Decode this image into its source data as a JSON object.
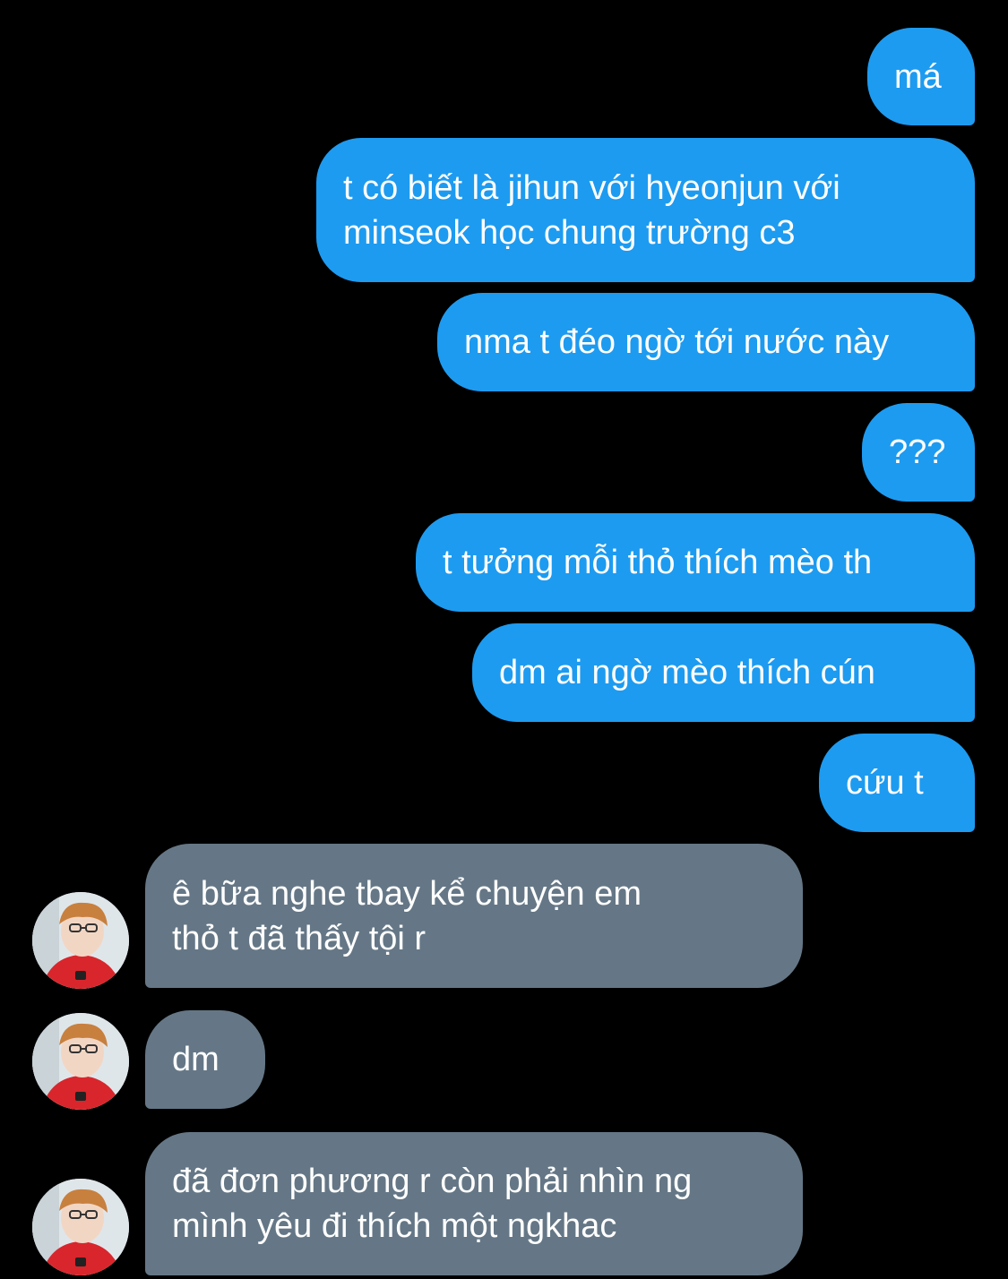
{
  "conversation": {
    "sent_messages": [
      {
        "text": "má"
      },
      {
        "text": "t có biết là jihun với hyeonjun với\nminseok học chung trường c3"
      },
      {
        "text": "nma t đéo ngờ tới nước này"
      },
      {
        "text": "???"
      },
      {
        "text": "t tưởng mỗi thỏ thích mèo th"
      },
      {
        "text": "dm ai ngờ mèo thích cún"
      },
      {
        "text": "cứu t"
      }
    ],
    "received_messages": [
      {
        "text": "ê bữa nghe tbay kể chuyện em\nthỏ t đã thấy tội r"
      },
      {
        "text": "dm"
      },
      {
        "text": "đã đơn phương r còn phải nhìn ng\nmình yêu đi thích một ngkhac"
      }
    ],
    "avatar_icon": "contact-avatar-photo",
    "colors": {
      "background": "#000000",
      "sent_bubble": "#1d9bf0",
      "received_bubble": "#657786",
      "text": "#ffffff"
    }
  }
}
